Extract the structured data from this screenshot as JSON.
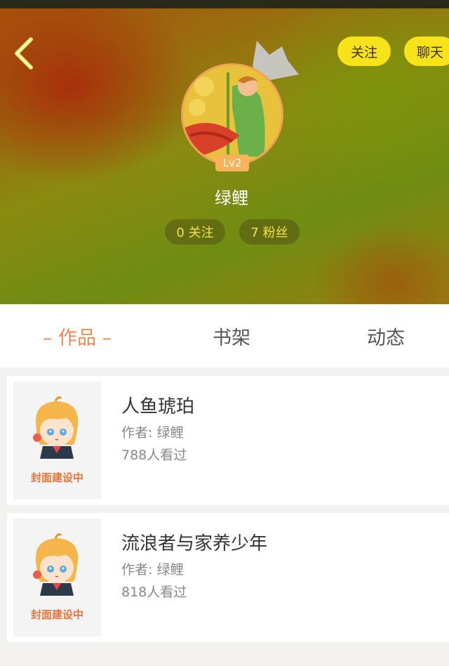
{
  "header": {
    "back_icon": "chevron-left-icon",
    "follow_label": "关注",
    "chat_label": "聊天"
  },
  "profile": {
    "level": "Lv2",
    "name": "绿鲤",
    "following": "0 关注",
    "fans": "7 粉丝"
  },
  "tabs": [
    {
      "label": "– 作品 –",
      "active": true
    },
    {
      "label": "书架",
      "active": false
    },
    {
      "label": "动态",
      "active": false
    }
  ],
  "books": [
    {
      "title": "人鱼琥珀",
      "author": "作者: 绿鲤",
      "views": "788人看过",
      "cover_label": "封面建设中"
    },
    {
      "title": "流浪者与家养少年",
      "author": "作者: 绿鲤",
      "views": "818人看过",
      "cover_label": "封面建设中"
    }
  ],
  "colors": {
    "accent": "#f08a50",
    "button_yellow": "#f8e21a",
    "stat_text": "#f5e24a"
  }
}
